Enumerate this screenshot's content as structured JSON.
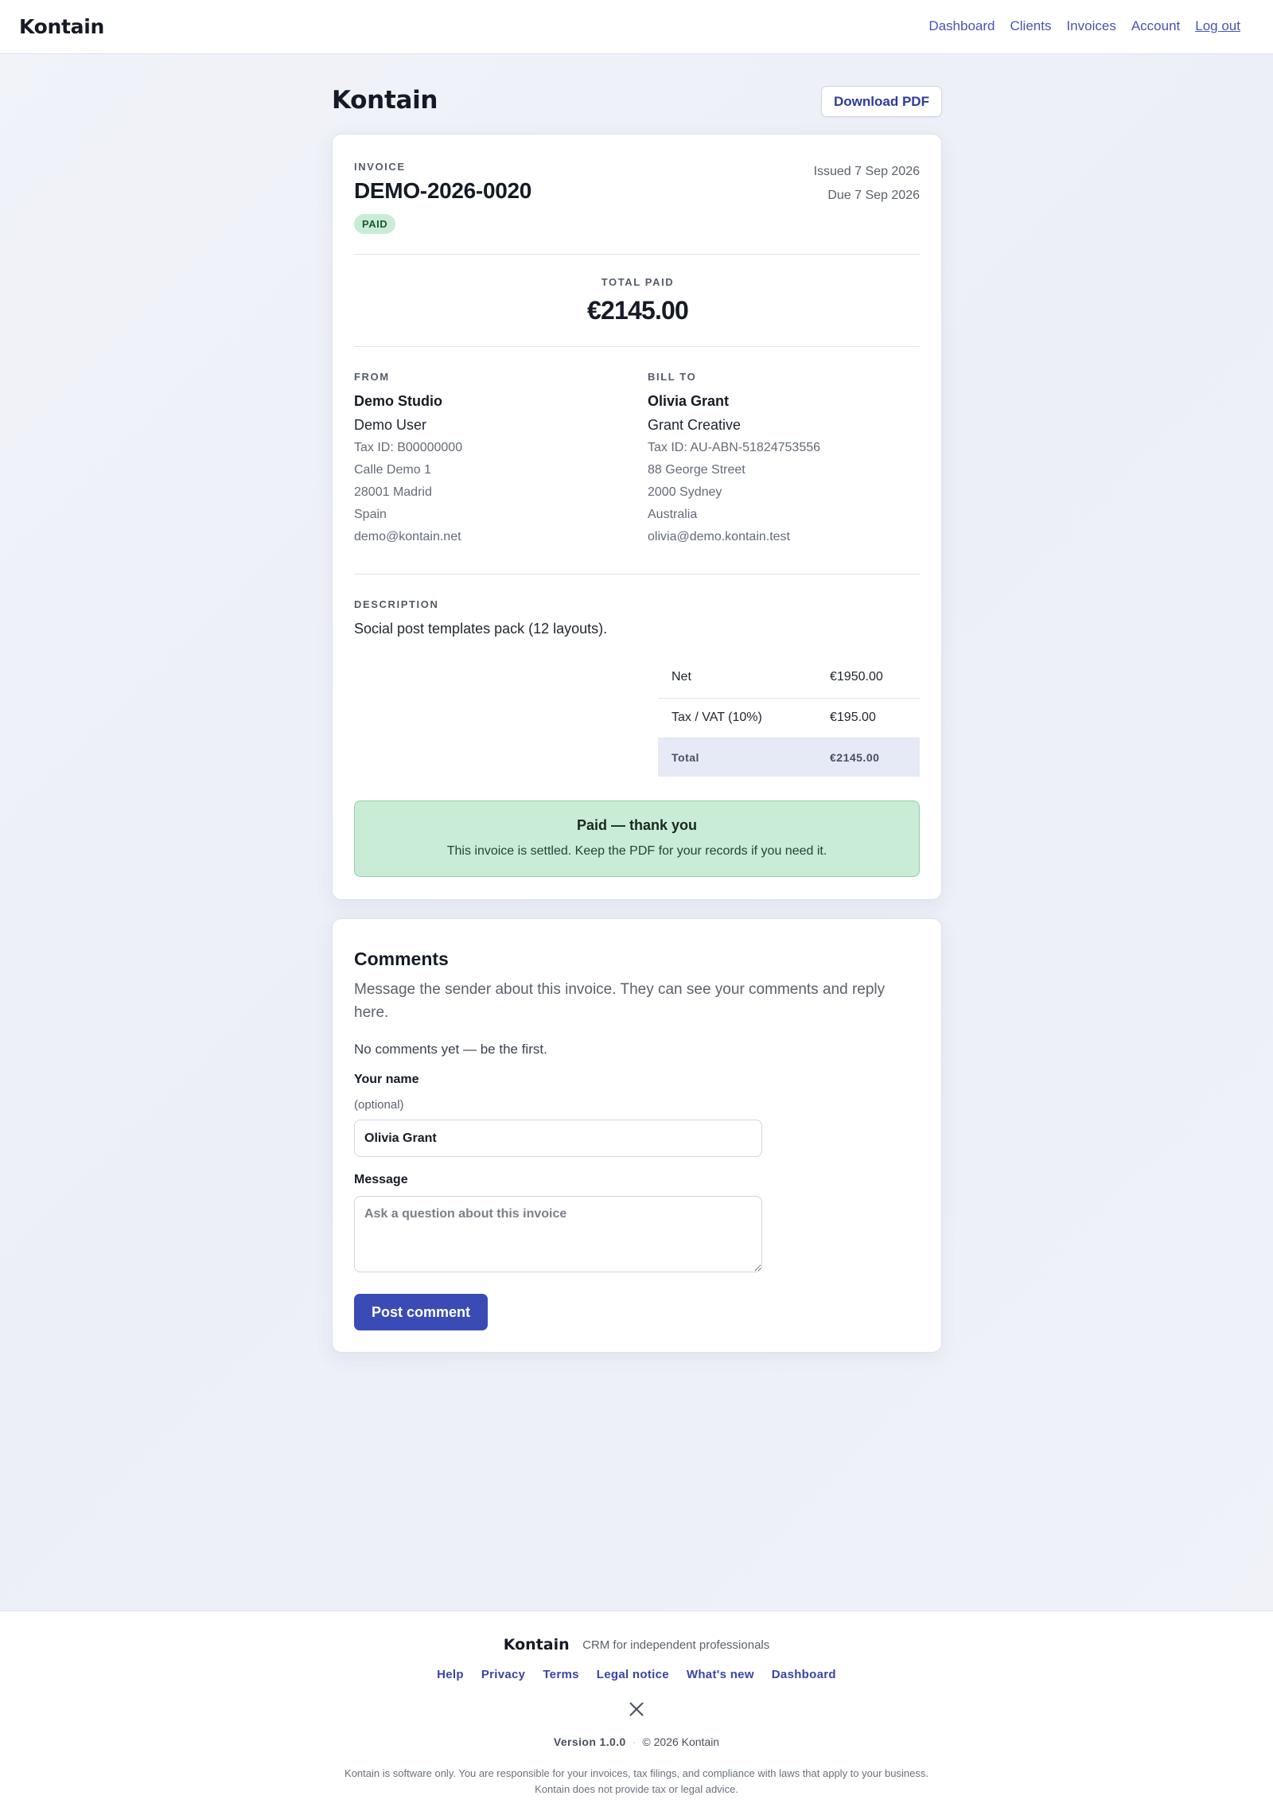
{
  "header": {
    "brand": "Kontain",
    "nav": [
      {
        "label": "Dashboard"
      },
      {
        "label": "Clients"
      },
      {
        "label": "Invoices"
      },
      {
        "label": "Account"
      },
      {
        "label": "Log out"
      }
    ]
  },
  "page": {
    "title": "Kontain",
    "download_label": "Download PDF"
  },
  "invoice": {
    "eyebrow": "INVOICE",
    "number": "DEMO-2026-0020",
    "status": "PAID",
    "issued": "Issued 7 Sep 2026",
    "due": "Due 7 Sep 2026",
    "total_label": "TOTAL PAID",
    "total_amount": "€2145.00",
    "from": {
      "label": "FROM",
      "name": "Demo Studio",
      "sub": "Demo User",
      "lines": [
        "Tax ID: B00000000",
        "Calle Demo 1",
        "28001 Madrid",
        "Spain",
        "demo@kontain.net"
      ]
    },
    "bill_to": {
      "label": "BILL TO",
      "name": "Olivia Grant",
      "sub": "Grant Creative",
      "lines": [
        "Tax ID: AU-ABN-51824753556",
        "88 George Street",
        "2000 Sydney",
        "Australia",
        "olivia@demo.kontain.test"
      ]
    },
    "description_label": "DESCRIPTION",
    "description": "Social post templates pack (12 layouts).",
    "totals": [
      {
        "label": "Net",
        "value": "€1950.00"
      },
      {
        "label": "Tax / VAT (10%)",
        "value": "€195.00"
      },
      {
        "label": "Total",
        "value": "€2145.00"
      }
    ],
    "paid_notice": {
      "title": "Paid — thank you",
      "text": "This invoice is settled. Keep the PDF for your records if you need it."
    }
  },
  "comments": {
    "title": "Comments",
    "intro": "Message the sender about this invoice. They can see your comments and reply here.",
    "empty": "No comments yet — be the first.",
    "name_label": "Your name",
    "name_hint": "(optional)",
    "name_value": "Olivia Grant",
    "message_label": "Message",
    "message_placeholder": "Ask a question about this invoice",
    "submit_label": "Post comment"
  },
  "footer": {
    "brand": "Kontain",
    "tagline": "CRM for independent professionals",
    "links": [
      {
        "label": "Help"
      },
      {
        "label": "Privacy"
      },
      {
        "label": "Terms"
      },
      {
        "label": "Legal notice"
      },
      {
        "label": "What's new"
      },
      {
        "label": "Dashboard"
      }
    ],
    "social_icon": "x-icon",
    "version": "Version 1.0.0",
    "copyright": "© 2026 Kontain",
    "legal": "Kontain is software only. You are responsible for your invoices, tax filings, and compliance with laws that apply to your business. Kontain does not provide tax or legal advice."
  }
}
